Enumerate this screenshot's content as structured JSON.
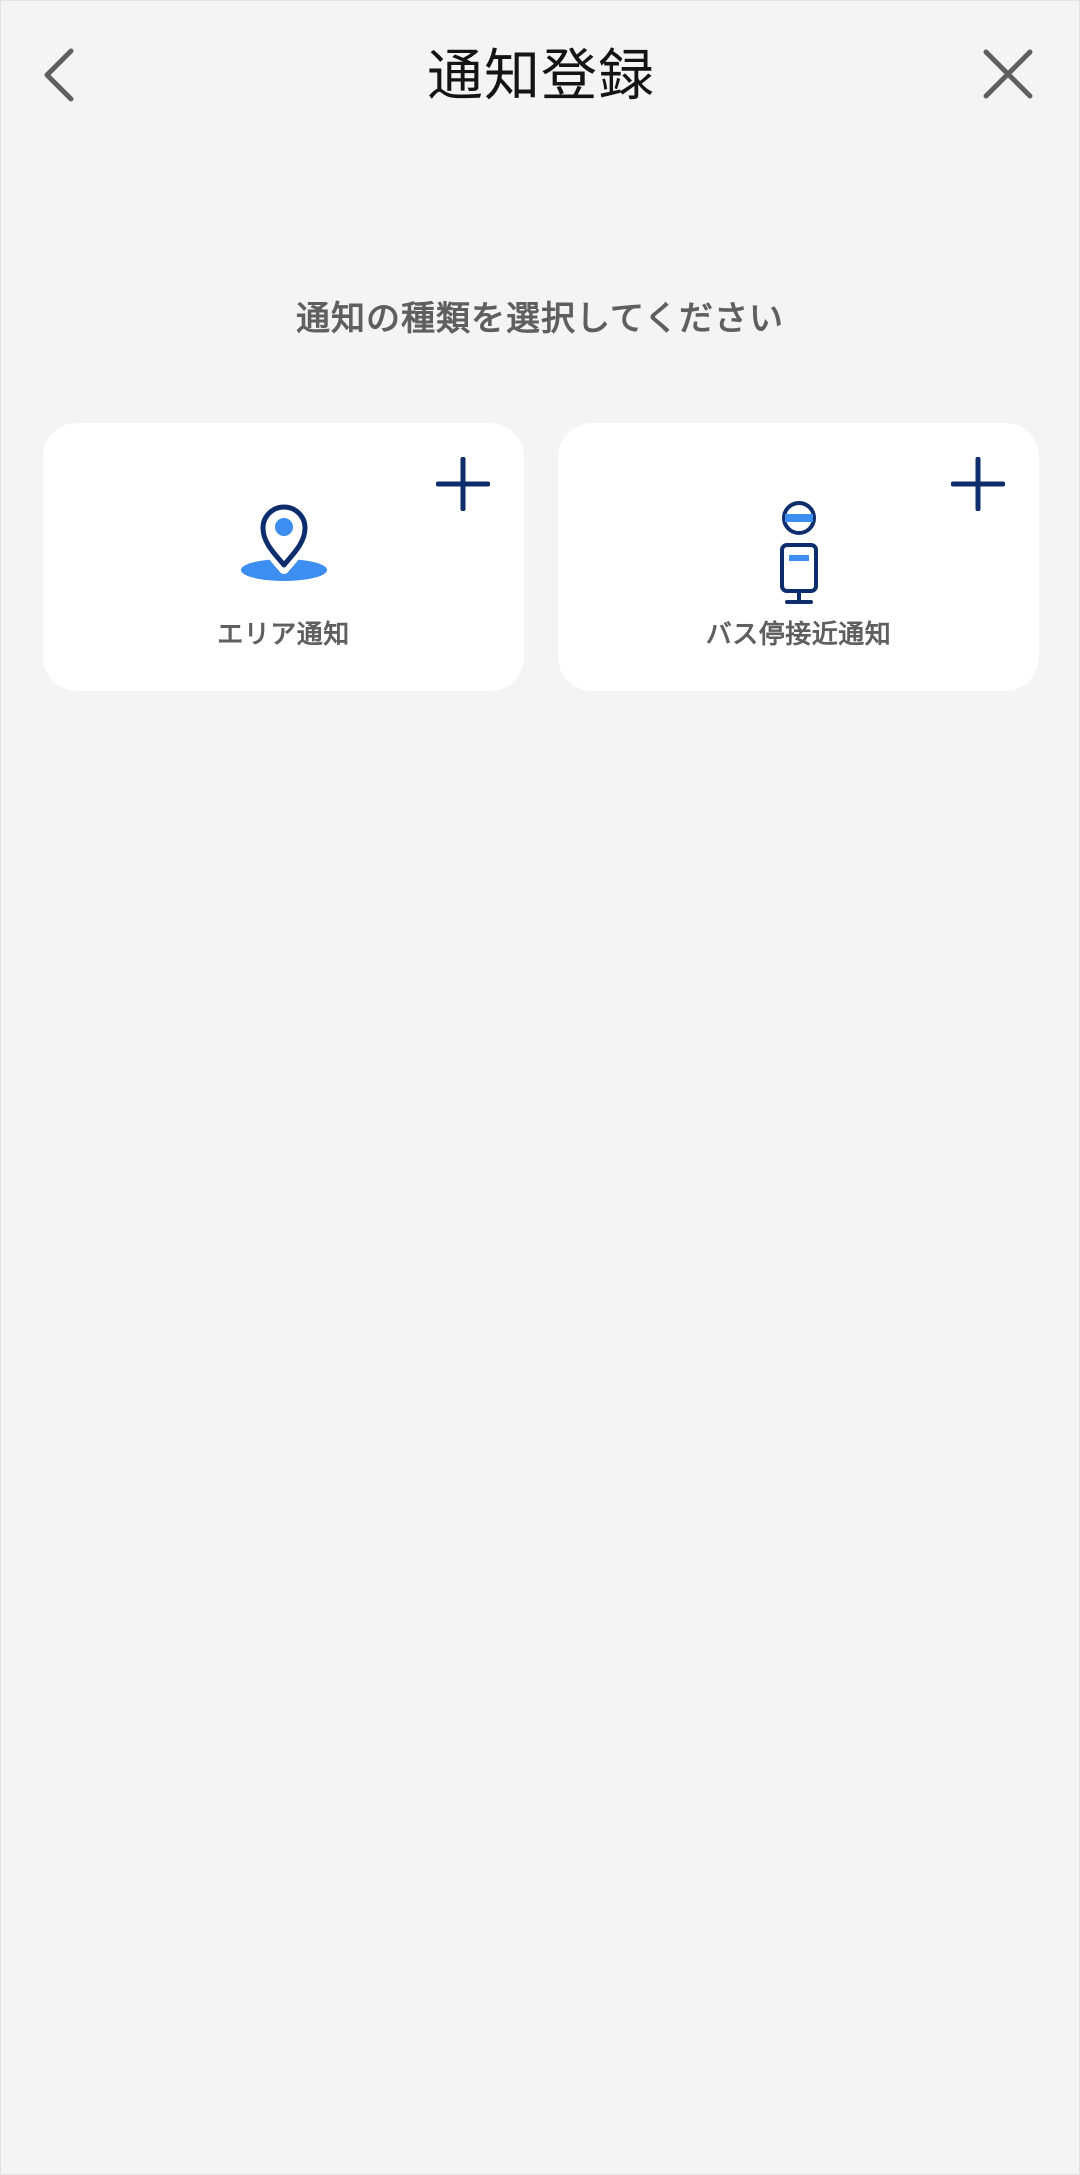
{
  "header": {
    "title": "通知登録",
    "back_icon": "chevron-left-icon",
    "close_icon": "close-icon"
  },
  "instruction": "通知の種類を選択してください",
  "cards": [
    {
      "label": "エリア通知",
      "icon": "map-pin-icon",
      "action_icon": "plus-icon"
    },
    {
      "label": "バス停接近通知",
      "icon": "bus-stop-icon",
      "action_icon": "plus-icon"
    }
  ],
  "colors": {
    "background": "#f4f4f4",
    "card": "#ffffff",
    "navy": "#0d2d6c",
    "accent_blue": "#3c8ef0",
    "text_gray": "#5f5f5f",
    "title_black": "#141414"
  }
}
